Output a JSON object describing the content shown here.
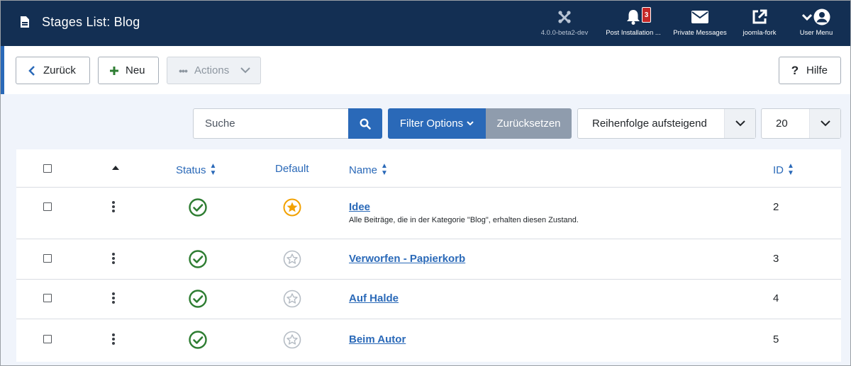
{
  "header": {
    "title": "Stages List: Blog",
    "version": "4.0.0-beta2-dev",
    "post_install_label": "Post Installation ...",
    "post_install_count": "3",
    "messages_label": "Private Messages",
    "site_label": "joomla-fork",
    "user_label": "User Menu"
  },
  "toolbar": {
    "back_label": "Zurück",
    "new_label": "Neu",
    "actions_label": "Actions",
    "help_label": "Hilfe"
  },
  "filters": {
    "search_placeholder": "Suche",
    "filter_options_label": "Filter Options",
    "reset_label": "Zurücksetzen",
    "ordering_selected": "Reihenfolge aufsteigend",
    "limit_selected": "20"
  },
  "table": {
    "columns": {
      "status": "Status",
      "default": "Default",
      "name": "Name",
      "id": "ID"
    },
    "rows": [
      {
        "name": "Idee",
        "description": "Alle Beiträge, die in der Kategorie \"Blog\", erhalten diesen Zustand.",
        "id": "2",
        "published": true,
        "is_default": true
      },
      {
        "name": "Verworfen - Papierkorb",
        "description": "",
        "id": "3",
        "published": true,
        "is_default": false
      },
      {
        "name": "Auf Halde",
        "description": "",
        "id": "4",
        "published": true,
        "is_default": false
      },
      {
        "name": "Beim Autor",
        "description": "",
        "id": "5",
        "published": true,
        "is_default": false
      }
    ]
  },
  "colors": {
    "header_bg": "#132f53",
    "primary": "#2a69b8",
    "success": "#2e7d32",
    "star_default": "#f2a100",
    "star_empty": "#b5bcc4"
  }
}
